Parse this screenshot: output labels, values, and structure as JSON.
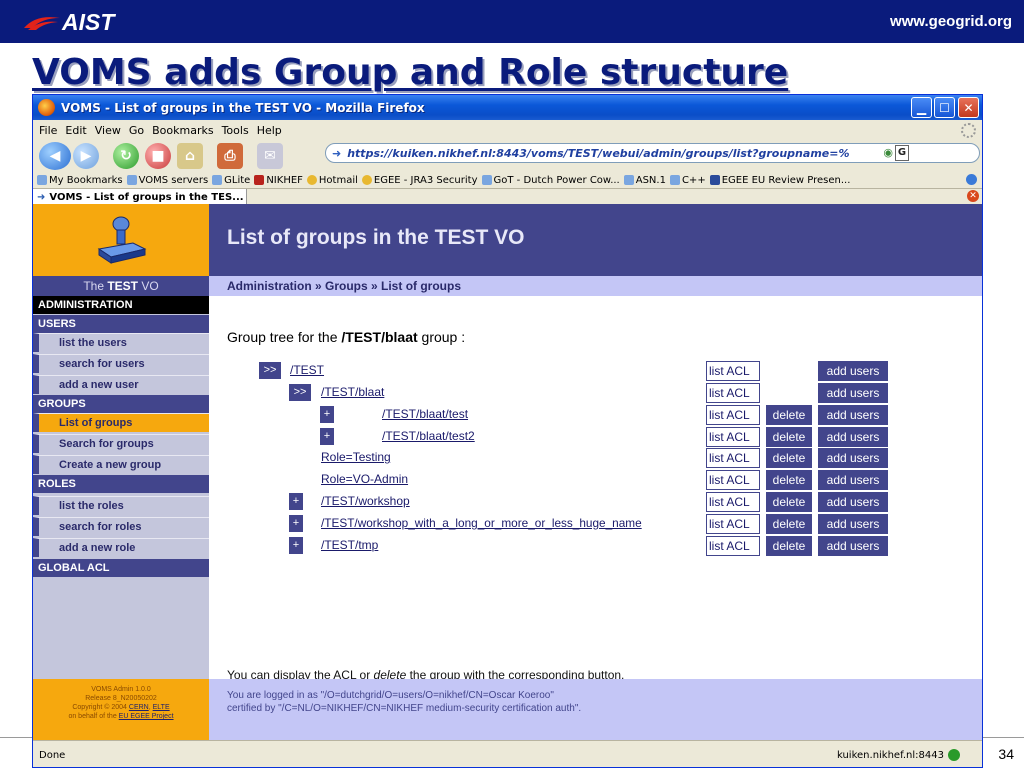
{
  "slide": {
    "logo_text": "AIST",
    "site_url": "www.geogrid.org",
    "title": "VOMS adds Group and Role structure",
    "page_number": "34"
  },
  "browser": {
    "window_title": "VOMS - List of groups in the TEST VO - Mozilla Firefox",
    "menu": [
      "File",
      "Edit",
      "View",
      "Go",
      "Bookmarks",
      "Tools",
      "Help"
    ],
    "url": "https://kuiken.nikhef.nl:8443/voms/TEST/webui/admin/groups/list?groupname=%",
    "search_glyph": "G",
    "bookmarks": [
      "My Bookmarks",
      "VOMS servers",
      "GLite",
      "NIKHEF",
      "Hotmail",
      "EGEE - JRA3 Security",
      "GoT - Dutch Power Cow...",
      "ASN.1",
      "C++",
      "EGEE EU Review Presen..."
    ],
    "tab_label": "VOMS - List of groups in the TES...",
    "status_text": "Done",
    "status_host": "kuiken.nikhef.nl:8443"
  },
  "sidebar": {
    "vo_prefix": "The ",
    "vo_name": "TEST",
    "vo_suffix": " VO",
    "sections": {
      "administration": "ADMINISTRATION",
      "users": "USERS",
      "groups": "GROUPS",
      "roles": "ROLES",
      "global_acl": "GLOBAL ACL"
    },
    "items": {
      "list_users": "list the users",
      "search_users": "search for users",
      "add_user": "add a new user",
      "list_groups": "List of groups",
      "search_groups": "Search for groups",
      "create_group": "Create a new group",
      "list_roles": "list the roles",
      "search_roles": "search for roles",
      "add_role": "add a new role"
    },
    "footer": {
      "line1": "VOMS Admin 1.0.0",
      "line2": "Release 8_N20050202",
      "line3_prefix": "Copyright © 2004 ",
      "cern": "CERN",
      "elte": "ELTE",
      "line4_prefix": "on behalf of the ",
      "project": "EU EGEE Project"
    }
  },
  "content": {
    "page_title": "List of groups in the TEST VO",
    "breadcrumb": "Administration » Groups » List of groups",
    "tree_prefix": "Group tree for the ",
    "tree_group": "/TEST/blaat",
    "tree_suffix": " group :",
    "buttons": {
      "acl": "list ACL",
      "delete": "delete",
      "add_users": "add users"
    },
    "rows": [
      {
        "toggle": ">>",
        "name": "/TEST"
      },
      {
        "toggle": ">>",
        "name": "/TEST/blaat"
      },
      {
        "toggle": "+",
        "name": "/TEST/blaat/test"
      },
      {
        "toggle": "+",
        "name": "/TEST/blaat/test2"
      },
      {
        "toggle": "",
        "name": "Role=Testing"
      },
      {
        "toggle": "",
        "name": "Role=VO-Admin"
      },
      {
        "toggle": "+",
        "name": "/TEST/workshop"
      },
      {
        "toggle": "+",
        "name": "/TEST/workshop_with_a_long_or_more_or_less_huge_name"
      },
      {
        "toggle": "+",
        "name": "/TEST/tmp"
      }
    ],
    "hint_part1": "You can display the ACL or ",
    "hint_delete": "delete",
    "hint_part2": " the group with the corresponding button.",
    "footer_line1": "You are logged in as \"/O=dutchgrid/O=users/O=nikhef/CN=Oscar Koeroo\"",
    "footer_line2": "certified by \"/C=NL/O=NIKHEF/CN=NIKHEF medium-security certification auth\"."
  },
  "colors": {
    "slide_bar": "#0a1b7c",
    "voms_purple": "#42458c",
    "voms_orange": "#f6a80e",
    "breadcrumb_bg": "#c4c6f6"
  }
}
